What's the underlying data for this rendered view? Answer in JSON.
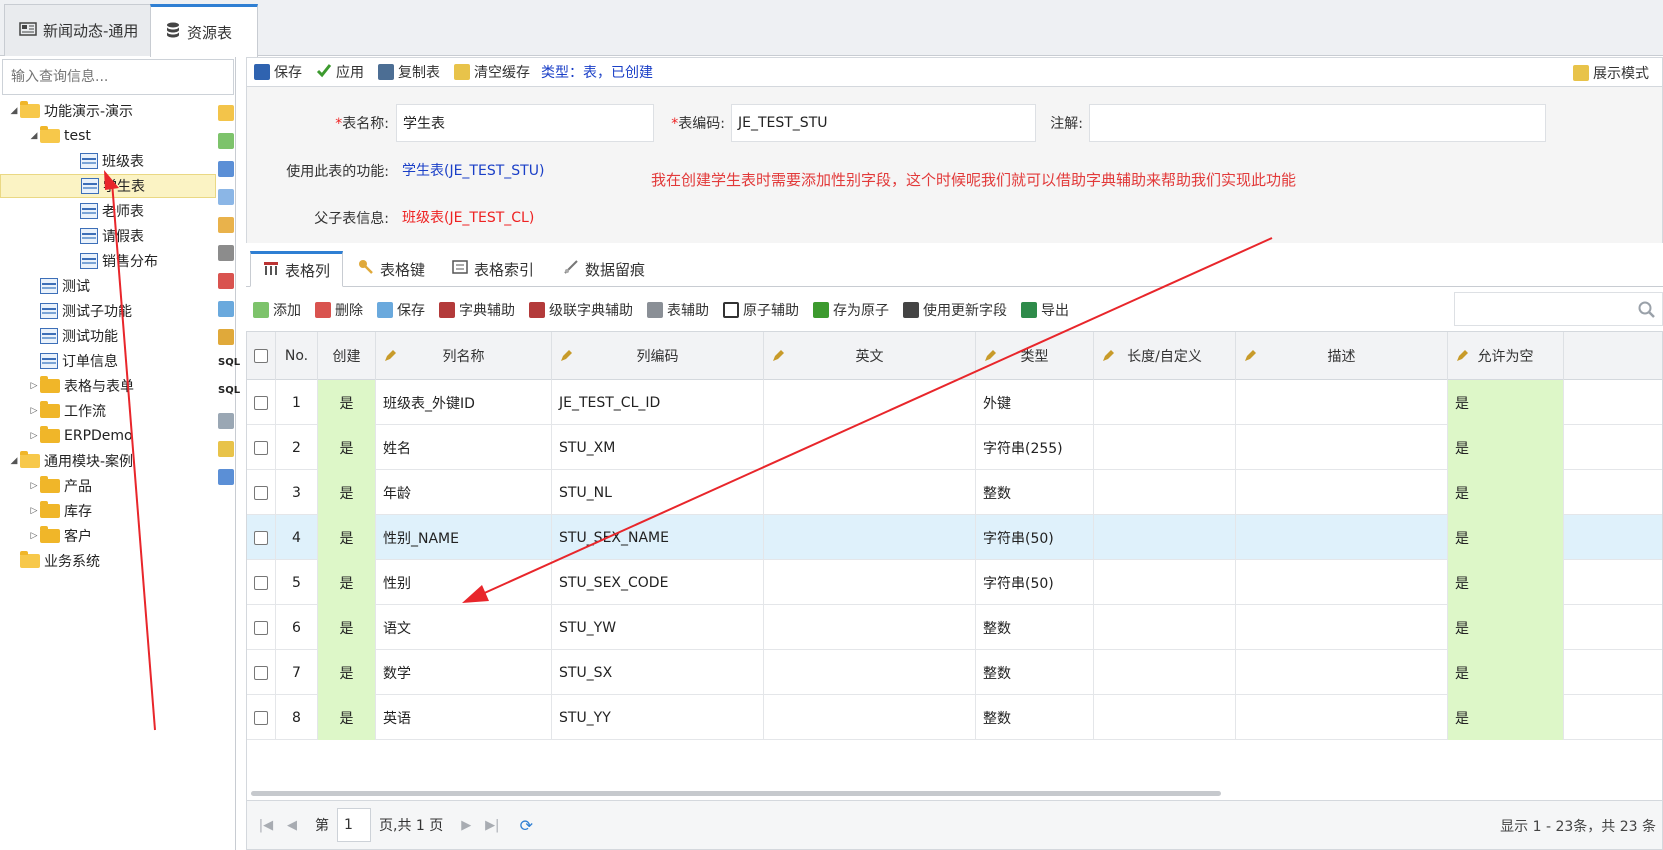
{
  "top_tabs": [
    {
      "label": "新闻动态-通用",
      "icon": "news-icon",
      "active": false
    },
    {
      "label": "资源表",
      "icon": "database-icon",
      "active": true
    }
  ],
  "left": {
    "search_placeholder": "输入查询信息...",
    "tree": [
      {
        "label": "功能演示-演示",
        "type": "folder-open",
        "level": 0,
        "toggle": "◢"
      },
      {
        "label": "test",
        "type": "folder-open",
        "level": 1,
        "toggle": "◢"
      },
      {
        "label": "班级表",
        "type": "table",
        "level": 2
      },
      {
        "label": "学生表",
        "type": "table",
        "level": 2,
        "selected": true
      },
      {
        "label": "老师表",
        "type": "table",
        "level": 2
      },
      {
        "label": "请假表",
        "type": "table",
        "level": 2
      },
      {
        "label": "销售分布",
        "type": "table",
        "level": 2
      },
      {
        "label": "测试",
        "type": "table",
        "level": 1
      },
      {
        "label": "测试子功能",
        "type": "table",
        "level": 1
      },
      {
        "label": "测试功能",
        "type": "table",
        "level": 1
      },
      {
        "label": "订单信息",
        "type": "table",
        "level": 1
      },
      {
        "label": "表格与表单",
        "type": "folder",
        "level": 1,
        "toggle": "▷"
      },
      {
        "label": "工作流",
        "type": "folder",
        "level": 1,
        "toggle": "▷"
      },
      {
        "label": "ERPDemo",
        "type": "folder",
        "level": 1,
        "toggle": "▷"
      },
      {
        "label": "通用模块-案例",
        "type": "folder-open",
        "level": 0,
        "toggle": "◢"
      },
      {
        "label": "产品",
        "type": "folder",
        "level": 1,
        "toggle": "▷"
      },
      {
        "label": "库存",
        "type": "folder",
        "level": 1,
        "toggle": "▷"
      },
      {
        "label": "客户",
        "type": "folder",
        "level": 1,
        "toggle": "▷"
      },
      {
        "label": "业务系统",
        "type": "folder-open",
        "level": 0
      }
    ]
  },
  "toolbar": {
    "save": "保存",
    "apply": "应用",
    "copy_table": "复制表",
    "clear_cache": "清空缓存",
    "type_info": "类型：表，已创建",
    "show_mode": "展示模式"
  },
  "form": {
    "table_name_label": "表名称:",
    "table_name": "学生表",
    "table_code_label": "表编码:",
    "table_code": "JE_TEST_STU",
    "comment_label": "注解:",
    "comment": "",
    "functions_label": "使用此表的功能:",
    "functions_value": "学生表(JE_TEST_STU)",
    "parent_label": "父子表信息:",
    "parent_value": "班级表(JE_TEST_CL)",
    "annotation": "我在创建学生表时需要添加性别字段，这个时候呢我们就可以借助字典辅助来帮助我们实现此功能"
  },
  "sub_tabs": [
    "表格列",
    "表格键",
    "表格索引",
    "数据留痕"
  ],
  "grid_toolbar": {
    "add": "添加",
    "delete": "删除",
    "save": "保存",
    "dict_helper": "字典辅助",
    "cascade_dict_helper": "级联字典辅助",
    "table_helper": "表辅助",
    "atom_helper": "原子辅助",
    "save_atom": "存为原子",
    "use_update_field": "使用更新字段",
    "export": "导出"
  },
  "grid": {
    "headers": [
      "No.",
      "创建",
      "列名称",
      "列编码",
      "英文",
      "类型",
      "长度/自定义",
      "描述",
      "允许为空"
    ],
    "rows": [
      {
        "no": "1",
        "created": "是",
        "name": "班级表_外键ID",
        "code": "JE_TEST_CL_ID",
        "en": "",
        "type": "外键",
        "length": "",
        "desc": "",
        "nullable": "是"
      },
      {
        "no": "2",
        "created": "是",
        "name": "姓名",
        "code": "STU_XM",
        "en": "",
        "type": "字符串(255)",
        "length": "",
        "desc": "",
        "nullable": "是"
      },
      {
        "no": "3",
        "created": "是",
        "name": "年龄",
        "code": "STU_NL",
        "en": "",
        "type": "整数",
        "length": "",
        "desc": "",
        "nullable": "是"
      },
      {
        "no": "4",
        "created": "是",
        "name": "性别_NAME",
        "code": "STU_SEX_NAME",
        "en": "",
        "type": "字符串(50)",
        "length": "",
        "desc": "",
        "nullable": "是",
        "highlight": true
      },
      {
        "no": "5",
        "created": "是",
        "name": "性别",
        "code": "STU_SEX_CODE",
        "en": "",
        "type": "字符串(50)",
        "length": "",
        "desc": "",
        "nullable": "是"
      },
      {
        "no": "6",
        "created": "是",
        "name": "语文",
        "code": "STU_YW",
        "en": "",
        "type": "整数",
        "length": "",
        "desc": "",
        "nullable": "是"
      },
      {
        "no": "7",
        "created": "是",
        "name": "数学",
        "code": "STU_SX",
        "en": "",
        "type": "整数",
        "length": "",
        "desc": "",
        "nullable": "是"
      },
      {
        "no": "8",
        "created": "是",
        "name": "英语",
        "code": "STU_YY",
        "en": "",
        "type": "整数",
        "length": "",
        "desc": "",
        "nullable": "是"
      }
    ]
  },
  "pager": {
    "page_label": "第",
    "page": "1",
    "page_total": "页,共 1 页",
    "display_text": "显示 1 - 23条，共 23 条"
  },
  "colors": {
    "accent": "#2f7fd3",
    "annotation_red": "#e23a3a",
    "created_green": "#ddf7c8",
    "row_highlight": "#dff1fb",
    "selected_node": "#fbf3c4"
  }
}
